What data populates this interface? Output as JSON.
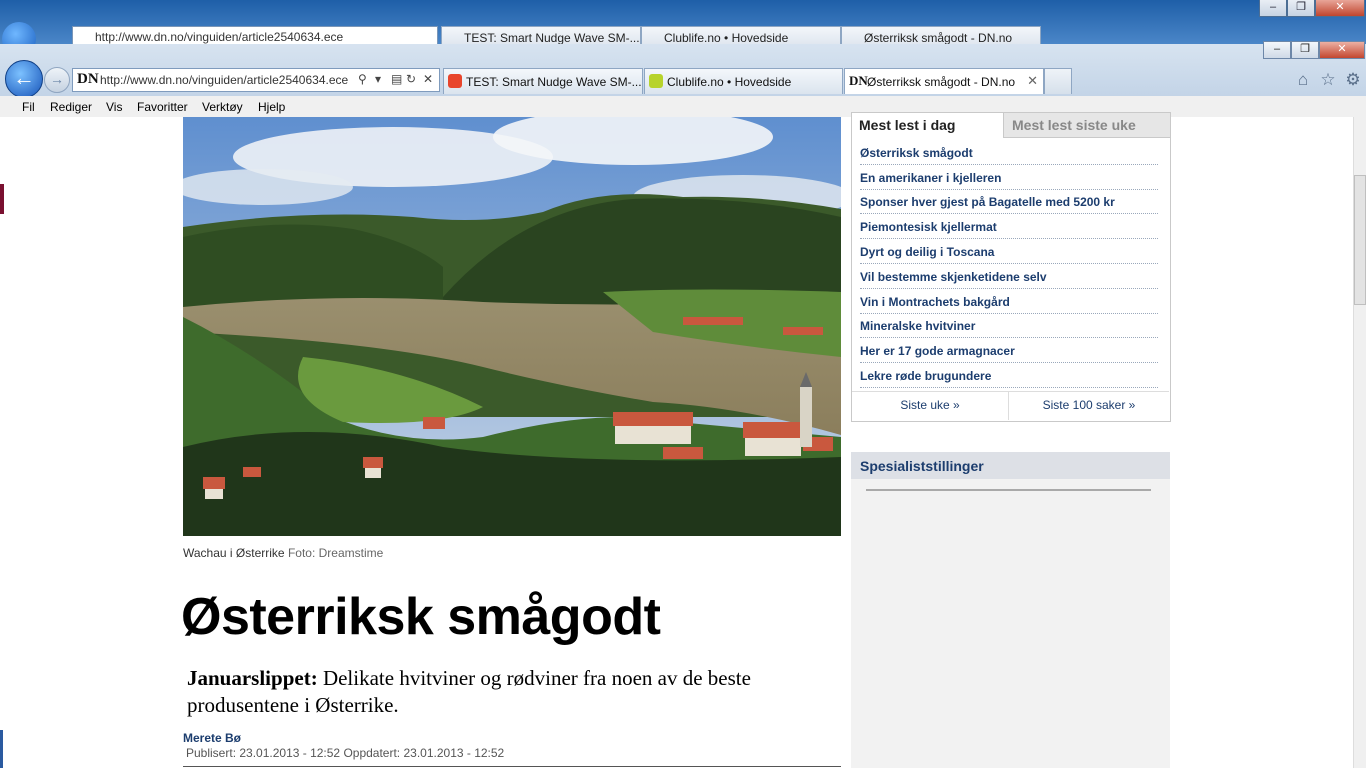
{
  "ghost_window": {
    "url": "http://www.dn.no/vinguiden/article2540634.ece",
    "tabs": [
      "TEST: Smart Nudge Wave SM-...",
      "Clublife.no • Hovedside",
      "Østerriksk smågodt - DN.no"
    ]
  },
  "browser": {
    "back_label": "←",
    "forward_label": "→",
    "site_logo": "DN",
    "url": "http://www.dn.no/vinguiden/article2540634.ece",
    "search_glyph": "⚲",
    "dropdown_glyph": "▾",
    "compat_glyph": "▤",
    "refresh_glyph": "↻",
    "stop_glyph": "✕",
    "window_buttons": [
      "–",
      "❐",
      "✕"
    ],
    "tabs": [
      {
        "label": "TEST: Smart Nudge Wave SM-...",
        "icon_color": "#e8452c"
      },
      {
        "label": "Clublife.no • Hovedside",
        "icon_color": "#b7d32c"
      },
      {
        "label": "Østerriksk smågodt - DN.no",
        "icon_color": "#ffffff"
      }
    ],
    "tab_close": "✕",
    "right_icons": [
      "⌂",
      "☆",
      "⚙"
    ]
  },
  "menubar": [
    "Fil",
    "Rediger",
    "Vis",
    "Favoritter",
    "Verktøy",
    "Hjelp"
  ],
  "article": {
    "photo_caption": "Wachau i Østerrike",
    "photo_credit": "Foto: Dreamstime",
    "headline": "Østerriksk smågodt",
    "lead_kicker": "Januarslippet:",
    "lead_text": " Delikate hvitviner og rødviner fra noen av de beste produsentene i Østerrike.",
    "author": "Merete Bø",
    "meta": "Publisert: 23.01.2013 - 12:52 Oppdatert: 23.01.2013 - 12:52"
  },
  "most_read": {
    "tab_today": "Mest lest i dag",
    "tab_week": "Mest lest siste uke",
    "items": [
      "Østerriksk smågodt",
      "En amerikaner i kjelleren",
      "Sponser hver gjest på Bagatelle med 5200 kr",
      "Piemontesisk kjellermat",
      "Dyrt og deilig i Toscana",
      "Vil bestemme skjenketidene selv",
      "Vin i Montrachets bakgård",
      "Mineralske hvitviner",
      "Her er 17 gode armagnacer",
      "Lekre røde brugundere"
    ],
    "footer_left": "Siste uke »",
    "footer_right": "Siste 100 saker »"
  },
  "specialists": {
    "title": "Spesialiststillinger"
  }
}
